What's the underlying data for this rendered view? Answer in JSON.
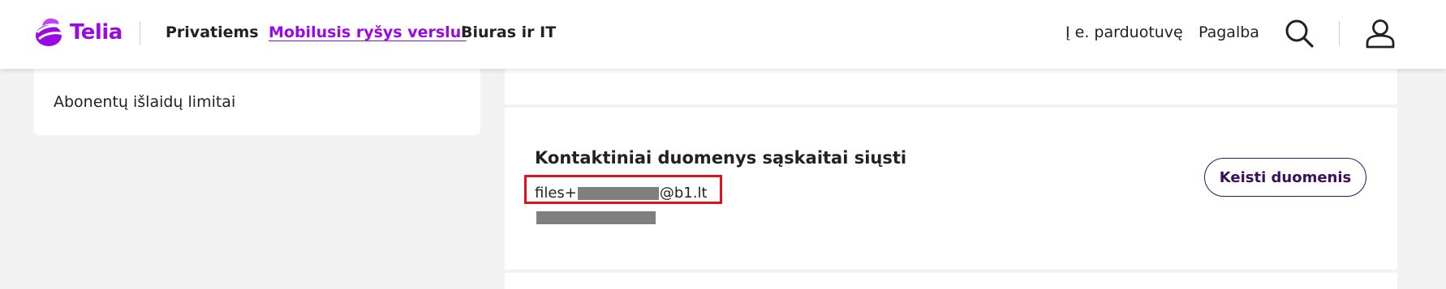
{
  "header": {
    "brand": "Telia",
    "nav": {
      "private": "Privatiems",
      "mobile_business": "Mobilusis ryšys verslui",
      "office_it": "Biuras ir IT"
    },
    "utility": {
      "eshop": "Į e. parduotuvę",
      "help": "Pagalba"
    },
    "icons": {
      "search": "search-icon",
      "user": "user-icon"
    },
    "colors": {
      "brand": "#990ae3",
      "button_text": "#3a0f5c"
    }
  },
  "sidebar": {
    "items": [
      {
        "label": "Abonentų išlaidų limitai"
      }
    ]
  },
  "main": {
    "contact_section": {
      "title": "Kontaktiniai duomenys sąskaitai siųsti",
      "email_prefix": "files+",
      "email_suffix": "@b1.lt",
      "edit_button": "Keisti duomenis"
    }
  }
}
